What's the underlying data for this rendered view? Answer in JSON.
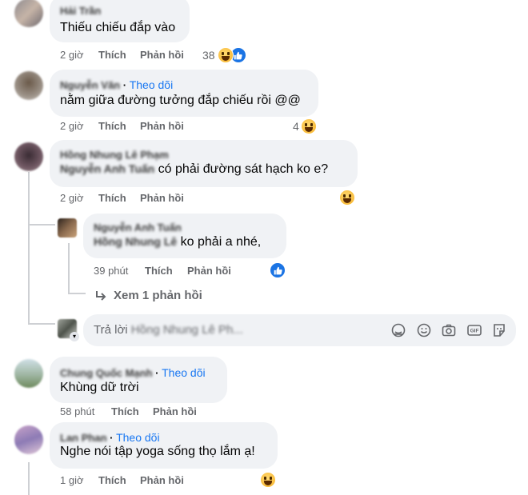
{
  "comments": [
    {
      "author": "Hải Trần",
      "text": "Thiếu chiếu đắp vào",
      "time": "2 giờ",
      "like_label": "Thích",
      "reply_label": "Phản hồi",
      "reaction_count": "38",
      "reactions": [
        "haha-icon",
        "like-icon"
      ]
    },
    {
      "author": "Nguyễn Văn",
      "follow_label": "Theo dõi",
      "text": "nằm giữa đường tưởng đắp chiếu rồi @@",
      "time": "2 giờ",
      "like_label": "Thích",
      "reply_label": "Phản hồi",
      "reaction_count": "4",
      "reactions": [
        "haha-icon"
      ]
    },
    {
      "author": "Hồng Nhung Lê Phạm",
      "mention": "Nguyễn Anh Tuấn",
      "text": "có phải đường sát hạch ko e?",
      "time": "2 giờ",
      "like_label": "Thích",
      "reply_label": "Phản hồi",
      "reactions": [
        "haha-icon"
      ],
      "replies": [
        {
          "author": "Nguyễn Anh Tuấn",
          "mention": "Hồng Nhung Lê",
          "text": "ko phải a nhé,",
          "time": "39 phút",
          "like_label": "Thích",
          "reply_label": "Phản hồi",
          "reactions": [
            "like-icon"
          ]
        }
      ],
      "view_more_label": "Xem 1 phản hồi",
      "reply_box": {
        "placeholder_prefix": "Trả lời",
        "placeholder_name": "Hồng Nhung Lê Ph..."
      }
    },
    {
      "author": "Chung Quốc Mạnh",
      "follow_label": "Theo dõi",
      "text": "Khùng dữ trời",
      "time": "58 phút",
      "like_label": "Thích",
      "reply_label": "Phản hồi"
    },
    {
      "author": "Lan Phan",
      "follow_label": "Theo dõi",
      "text": "Nghe nói tập yoga sống thọ lắm ạ!",
      "time": "1 giờ",
      "like_label": "Thích",
      "reply_label": "Phản hồi",
      "reactions": [
        "haha-icon"
      ]
    }
  ],
  "colors": {
    "bubble": "#f0f2f5",
    "link": "#1877f2",
    "meta": "#65676b",
    "thread": "#ced0d4"
  }
}
